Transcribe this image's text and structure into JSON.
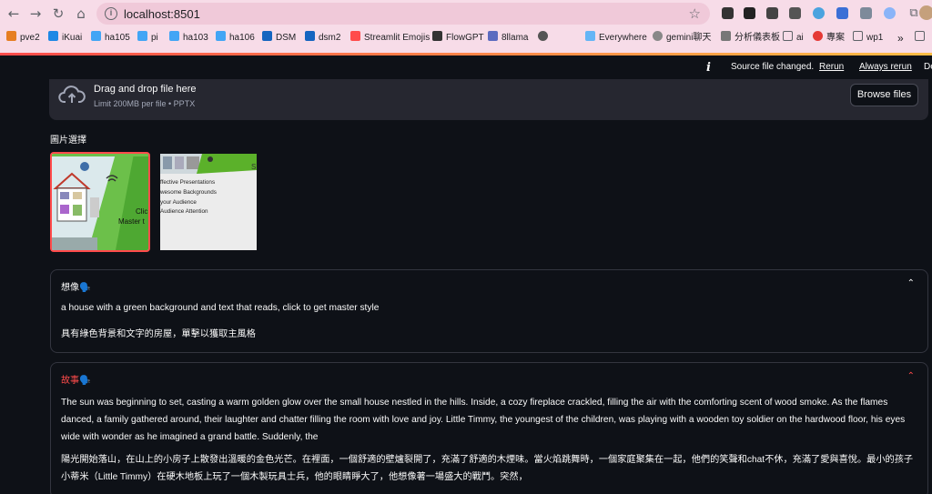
{
  "browser": {
    "url": "localhost:8501",
    "bookmarks": [
      "pve2",
      "iKuai",
      "ha105",
      "pi",
      "ha103",
      "ha106",
      "DSM",
      "dsm2",
      "Streamlit Emojis",
      "FlowGPT",
      "8llama",
      "Everywhere",
      "gemini聊天",
      "分析儀表板",
      "ai",
      "專案",
      "wp1"
    ],
    "more": "»"
  },
  "toolbar": {
    "info_glyph": "i",
    "message": "Source file changed.",
    "rerun": "Rerun",
    "always_rerun": "Always rerun",
    "deploy": "De"
  },
  "uploader": {
    "title": "Drag and drop file here",
    "subtitle": "Limit 200MB per file • PPTX",
    "button": "Browse files"
  },
  "gallery": {
    "label": "圖片選擇",
    "thumb1_text": [
      "Clic",
      "Master t"
    ],
    "thumb2_text": [
      "ffective Presentations",
      "wesome Backgrounds",
      "your Audience",
      "Audience Attention",
      "S"
    ]
  },
  "expander1": {
    "title": "想像🗣️",
    "chevron": "⌃",
    "en": "a house with a green background and text that reads, click to get master style",
    "zh": "具有綠色背景和文字的房屋，單擊以獲取主風格"
  },
  "expander2": {
    "title": "故事🗣️",
    "chevron": "⌃",
    "en": "The sun was beginning to set, casting a warm golden glow over the small house nestled in the hills. Inside, a cozy fireplace crackled, filling the air with the comforting scent of wood smoke. As the flames danced, a family gathered around, their laughter and chatter filling the room with love and joy. Little Timmy, the youngest of the children, was playing with a wooden toy soldier on the hardwood floor, his eyes wide with wonder as he imagined a grand battle. Suddenly, the",
    "zh": "陽光開始落山，在山上的小房子上散發出溫暖的金色光芒。在裡面，一個舒適的壁爐裂開了，充滿了舒適的木煙味。當火焰跳舞時，一個家庭聚集在一起，他們的笑聲和chat不休，充滿了愛與喜悅。最小的孩子小蒂米（Little Timmy）在硬木地板上玩了一個木製玩具士兵，他的眼睛睜大了，他想像著一場盛大的戰鬥。突然，"
  },
  "colors": {
    "accent": "#ff4b4b",
    "bg": "#0e1117",
    "panel": "#262730"
  }
}
